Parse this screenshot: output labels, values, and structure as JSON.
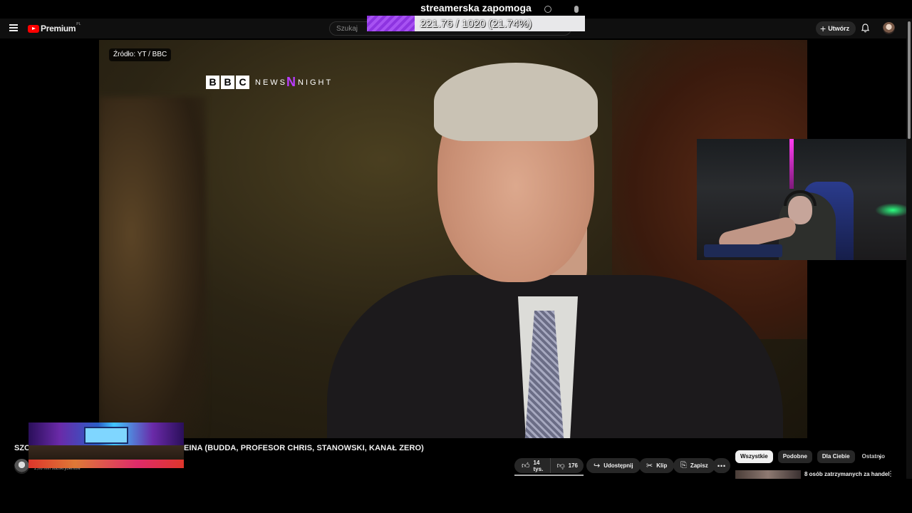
{
  "topbar": {
    "logo_text": "Premium",
    "logo_region": "PL",
    "search_placeholder": "Szukaj",
    "create_label": "Utwórz"
  },
  "donation": {
    "title": "streamerska zapomoga",
    "current": 221.76,
    "goal": 1020,
    "progress": 0.2174,
    "progress_text": "221.76 / 1020 (21.74%)",
    "fill_color": "#9b45ea"
  },
  "video": {
    "source_tag": "Źródło: YT / BBC",
    "brand_letters": [
      "B",
      "B",
      "C"
    ],
    "brand_news": "NEWS",
    "brand_n": "N",
    "brand_night": "NIGHT"
  },
  "watch": {
    "title_start": "SZO",
    "title_end": "EINA (BUDDA, PROFESOR CHRIS, STANOWSKI, KANAŁ ZERO)",
    "subscribers": "2,08 mln subskrybentów",
    "likes": "14 tys.",
    "dislikes": "176",
    "share_label": "Udostępnij",
    "clip_label": "Klip",
    "save_label": "Zapisz",
    "more_label": "⋯"
  },
  "chips": {
    "items": [
      "Wszystkie",
      "Podobne",
      "Dla Ciebie",
      "Ostatnio"
    ],
    "active_index": 0
  },
  "recommendation": {
    "title": "8 osób zatrzymanych za handel"
  },
  "colors": {
    "youtube_red": "#ff0000",
    "bbc_n_purple": "#b93cff",
    "page_bg": "#0f0f0f"
  },
  "icons": {
    "menu": "hamburger-icon",
    "search": "search-icon",
    "mic": "mic-icon",
    "bell": "bell-icon",
    "like": "thumb-up-icon",
    "dislike": "thumb-down-icon",
    "share": "share-arrow-icon",
    "clip": "scissors-icon",
    "save": "bookmark-icon",
    "next": "chevron-right-icon"
  }
}
